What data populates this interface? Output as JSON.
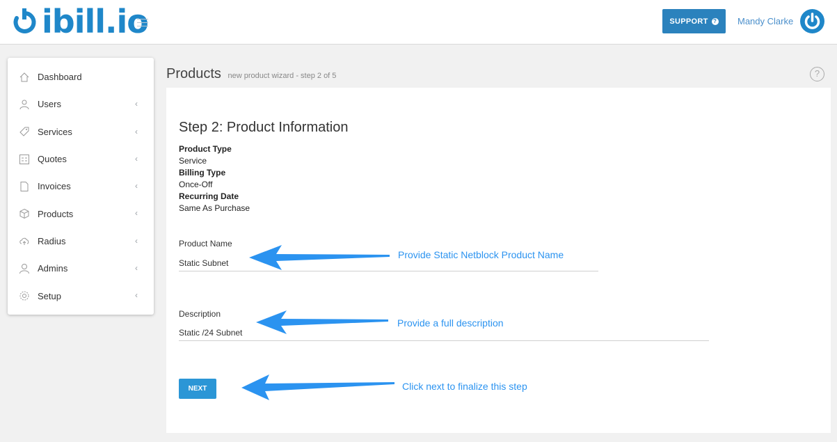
{
  "header": {
    "logo_text": "ibill.io",
    "support_label": "SUPPORT",
    "user_name": "Mandy Clarke"
  },
  "sidebar": {
    "items": [
      {
        "label": "Dashboard",
        "icon": "home-icon"
      },
      {
        "label": "Users",
        "icon": "users-icon"
      },
      {
        "label": "Services",
        "icon": "tag-icon"
      },
      {
        "label": "Quotes",
        "icon": "calculator-icon"
      },
      {
        "label": "Invoices",
        "icon": "document-icon"
      },
      {
        "label": "Products",
        "icon": "cube-icon"
      },
      {
        "label": "Radius",
        "icon": "cloud-upload-icon"
      },
      {
        "label": "Admins",
        "icon": "user-icon"
      },
      {
        "label": "Setup",
        "icon": "gear-icon"
      }
    ]
  },
  "page": {
    "title": "Products",
    "subtitle": "new product wizard - step 2 of 5"
  },
  "form": {
    "step_title": "Step 2: Product Information",
    "product_type_label": "Product Type",
    "product_type_value": "Service",
    "billing_type_label": "Billing Type",
    "billing_type_value": "Once-Off",
    "recurring_date_label": "Recurring Date",
    "recurring_date_value": "Same As Purchase",
    "product_name_label": "Product Name",
    "product_name_value": "Static Subnet",
    "description_label": "Description",
    "description_value": "Static /24 Subnet",
    "next_label": "NEXT"
  },
  "annotations": {
    "name_hint": "Provide Static Netblock Product Name",
    "description_hint": "Provide a full description",
    "next_hint": "Click next to finalize this step"
  },
  "colors": {
    "brand": "#1f87c9",
    "support_button": "#2b82bd",
    "next_button": "#2b96d6",
    "annotation": "#2b93f0"
  }
}
